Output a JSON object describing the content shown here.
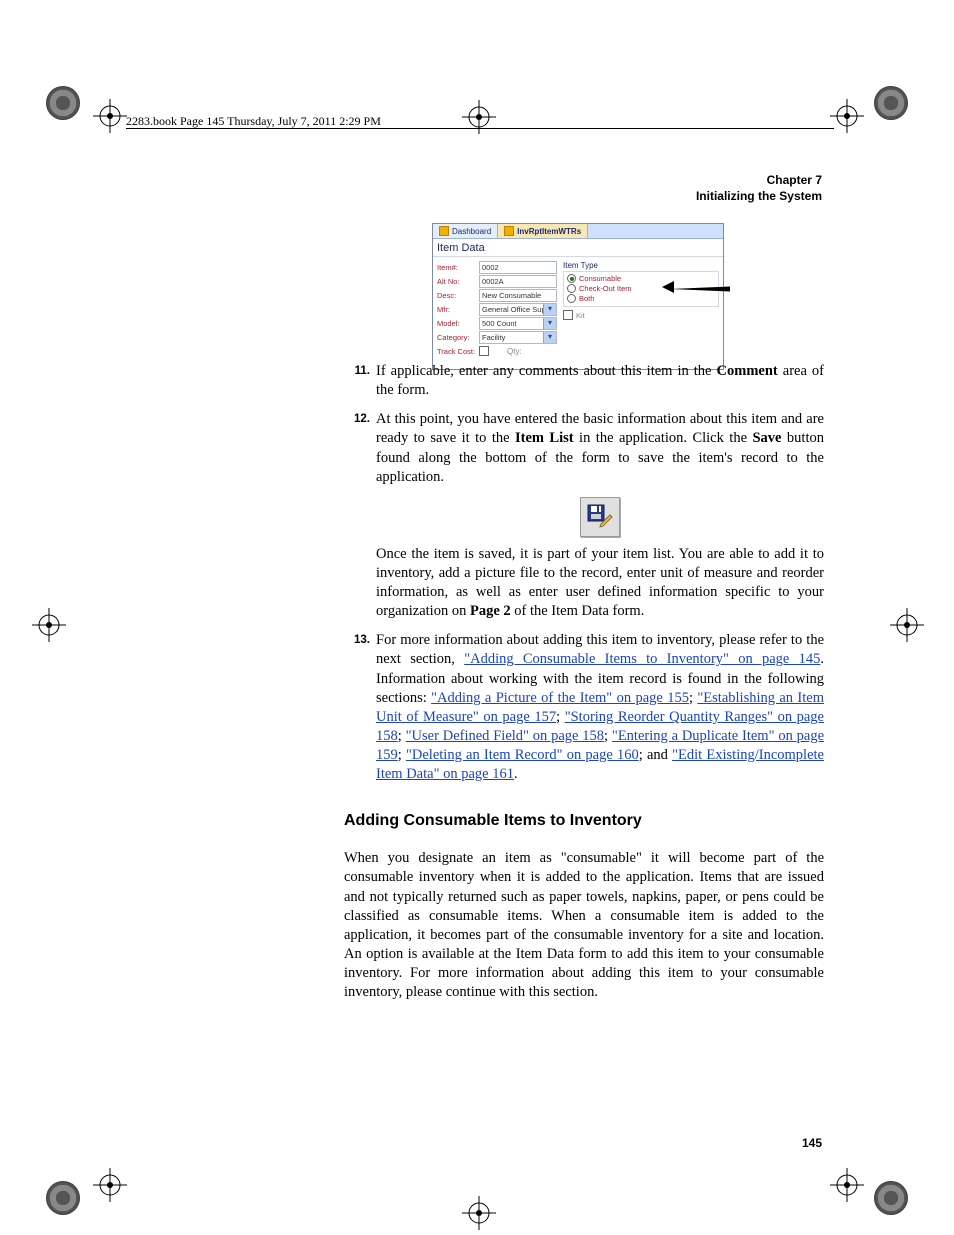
{
  "header_line": "2283.book  Page 145  Thursday, July 7, 2011  2:29 PM",
  "chapter": "Chapter 7",
  "chapter_title": "Initializing the System",
  "app": {
    "tabs": {
      "dashboard": "Dashboard",
      "active": "InvRptItemWTRs"
    },
    "title": "Item Data",
    "fields": {
      "item_no_lbl": "Item#:",
      "item_no": "0002",
      "alt_no_lbl": "Alt No:",
      "alt_no": "0002A",
      "desc_lbl": "Desc:",
      "desc": "New Consumable",
      "mfr_lbl": "Mfr:",
      "mfr": "General Office Supplie",
      "model_lbl": "Model:",
      "model": "500 Count",
      "category_lbl": "Category:",
      "category": "Facility",
      "track_lbl": "Track Cost:",
      "qty_lbl": "Qty:"
    },
    "itemtype": {
      "title": "Item Type",
      "consumable": "Consumable",
      "checkout": "Check-Out Item",
      "both": "Both",
      "kit": "Kit"
    }
  },
  "steps": {
    "s11_num": "11.",
    "s11_a": "If applicable, enter any comments about this item in the ",
    "s11_b": "Comment",
    "s11_c": " area of the form.",
    "s12_num": "12.",
    "s12_a": "At this point, you have entered the basic information about this item and are ready to save it to the ",
    "s12_b": "Item List",
    "s12_c": " in the application. Click the ",
    "s12_d": "Save",
    "s12_e": " button found along the bottom of the form to save the item's record to the application.",
    "s12_post_a": "Once the item is saved, it is part of your item list. You are able to add it to inventory, add a picture file to the record, enter unit of measure and reorder information, as well as enter user defined information specific to  your organization on ",
    "s12_post_b": "Page 2",
    "s12_post_c": " of the Item Data form.",
    "s13_num": "13.",
    "s13_a": "For more information about adding this item to inventory, please refer to the next section, ",
    "s13_link1": "\"Adding Consumable Items to Inventory\" on page 145",
    "s13_b": ". Information about working with the item record is found in the following sections: ",
    "s13_link2": "\"Adding a Picture of the Item\" on page 155",
    "s13_link3": "\"Establishing an Item Unit of Measure\" on page 157",
    "s13_link4": "\"Storing Reorder Quantity Ranges\" on page 158",
    "s13_link5": "\"User Defined Field\" on page 158",
    "s13_link6": "\"Entering a Duplicate Item\" on page 159",
    "s13_link7": "\"Deleting an Item Record\" on page 160",
    "s13_link8": "\"Edit Existing/Incomplete Item Data\" on page 161",
    "sep_semi": "; ",
    "sep_and": "; and ",
    "period": "."
  },
  "section_heading": "Adding Consumable Items to Inventory",
  "section_body": "When you designate an item as \"consumable\" it will become part of the consumable inventory when it is added to the application. Items that are issued and not typically returned such as paper towels, napkins, paper, or pens could be classified as consumable items. When a consumable item is added to the application, it becomes part of the consumable inventory for a site and location. An option is available at the Item Data form to add this item to your consumable inventory. For more information about adding this item to your consumable inventory, please continue with this section.",
  "page_number": "145"
}
